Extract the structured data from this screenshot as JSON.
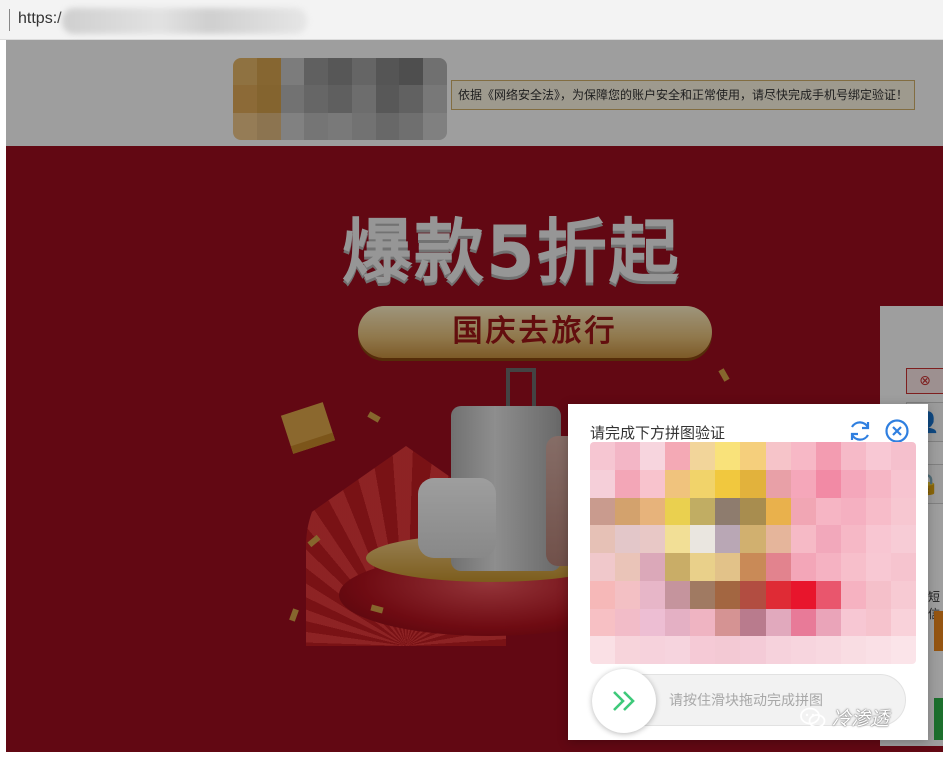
{
  "browser": {
    "url_prefix": "https:/"
  },
  "header": {
    "notice": "依据《网络安全法》，为保障您的账户安全和正常使用，请尽快完成手机号绑定验证！"
  },
  "banner": {
    "headline": "爆款5折起",
    "subheadline": "国庆去旅行"
  },
  "login_panel": {
    "partial_text_1": "短信",
    "partial_text_2": "QQ"
  },
  "captcha": {
    "title": "请完成下方拼图验证",
    "refresh_icon": "refresh-icon",
    "close_icon": "close-icon",
    "slider_hint": "请按住滑块拖动完成拼图",
    "slider_icon": "double-chevron-right-icon",
    "accent_color": "#3ec97a",
    "puzzle_image_pixelated": true
  },
  "watermark": {
    "text": "冷渗透",
    "icon": "wechat-icon"
  },
  "colors": {
    "banner_red": "#9e0d1f",
    "icon_blue": "#2f7fe0"
  }
}
